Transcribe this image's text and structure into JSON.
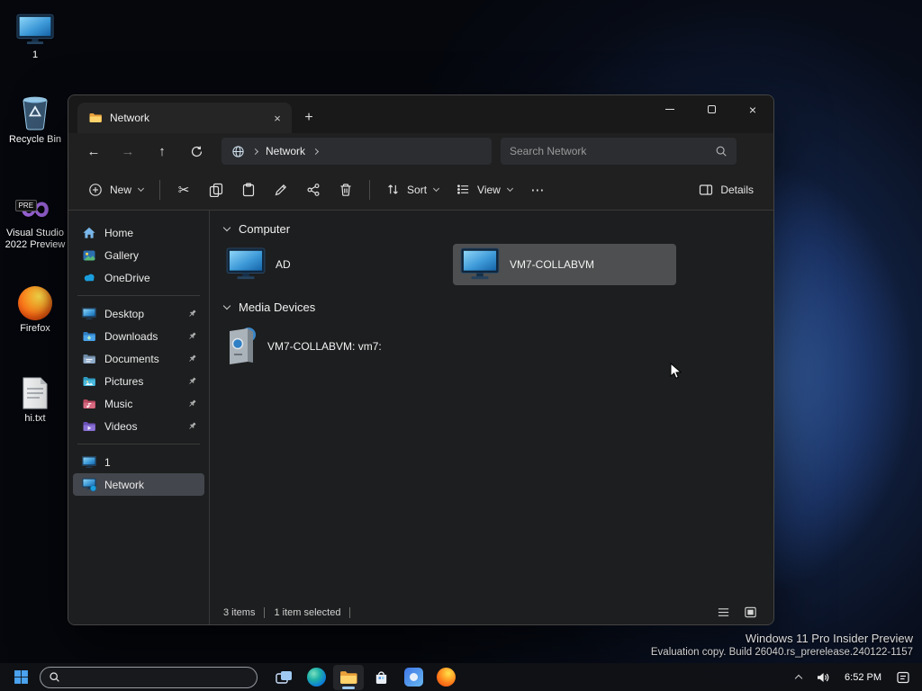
{
  "colors": {
    "accent_blue": "#4cc2ff",
    "selection_gray": "#55585c",
    "folder_yellow": "#ffd36b",
    "taskbar_bg": "#121418"
  },
  "glyphs": {
    "back": "←",
    "forward": "→",
    "up": "↑",
    "plus": "+",
    "more": "⋯",
    "close": "×",
    "scissors": "✂",
    "infinity": "∞"
  },
  "desktop": {
    "icons": [
      {
        "label": "1"
      },
      {
        "label": "Recycle Bin"
      },
      {
        "label": "Visual Studio 2022 Preview",
        "badge": "PRE"
      },
      {
        "label": "Firefox"
      },
      {
        "label": "hi.txt"
      }
    ],
    "watermark": {
      "line1": "Windows 11 Pro Insider Preview",
      "line2": "Evaluation copy. Build 26040.rs_prerelease.240122-1157"
    }
  },
  "explorer": {
    "tab_title": "Network",
    "breadcrumb": {
      "root": "Network"
    },
    "search_placeholder": "Search Network",
    "toolbar": {
      "new": "New",
      "sort": "Sort",
      "view": "View",
      "details": "Details"
    },
    "sidebar": {
      "quick": [
        {
          "label": "Home"
        },
        {
          "label": "Gallery"
        },
        {
          "label": "OneDrive"
        }
      ],
      "pinned": [
        {
          "label": "Desktop"
        },
        {
          "label": "Downloads"
        },
        {
          "label": "Documents"
        },
        {
          "label": "Pictures"
        },
        {
          "label": "Music"
        },
        {
          "label": "Videos"
        }
      ],
      "drives": [
        {
          "label": "1"
        },
        {
          "label": "Network"
        }
      ]
    },
    "sections": [
      {
        "title": "Computer"
      },
      {
        "title": "Media Devices"
      }
    ],
    "items": {
      "computer": [
        {
          "name": "AD"
        },
        {
          "name": "VM7-COLLABVM",
          "selected": true
        }
      ],
      "media": [
        {
          "name": "VM7-COLLABVM: vm7:"
        }
      ]
    },
    "status": {
      "count": "3 items",
      "selected": "1 item selected"
    }
  },
  "taskbar": {
    "clock": "6:52 PM"
  }
}
